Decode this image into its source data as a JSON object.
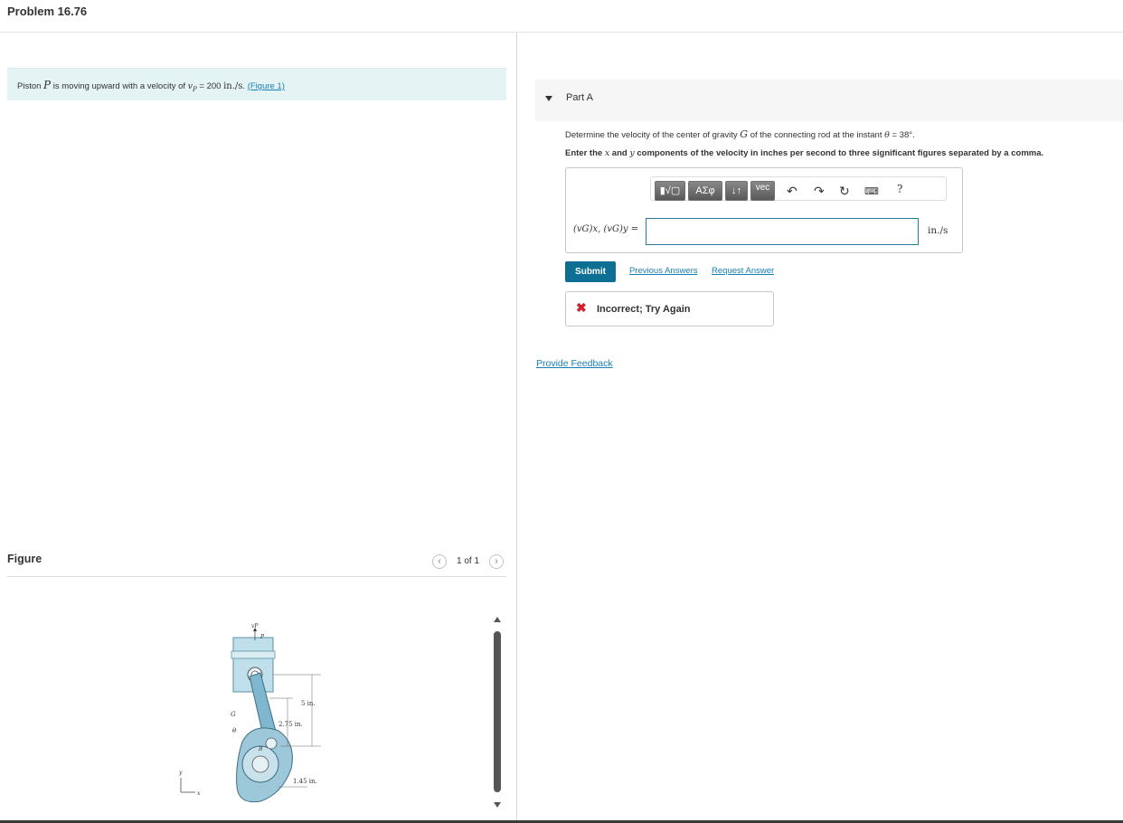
{
  "header": {
    "title": "Problem 16.76"
  },
  "intro": {
    "text_pre": "Piston ",
    "var_p": "P",
    "text_mid": " is moving upward with a velocity of ",
    "var_vp": "v",
    "var_vp_sub": "P",
    "value": " = 200 ",
    "unit": "in./s",
    "period": ". ",
    "figure_link": "(Figure 1)"
  },
  "figure_panel": {
    "title": "Figure",
    "pager_text": "1 of 1",
    "prev_icon": "chevron-left-icon",
    "next_icon": "chevron-right-icon",
    "labels": {
      "vp": "vP",
      "p": "P",
      "g": "G",
      "theta": "θ",
      "b": "B",
      "a": "A",
      "dim_5in": "5 in.",
      "dim_275in": "2.75 in.",
      "dim_145in": "1.45 in.",
      "axis_y": "y",
      "axis_x": "x"
    }
  },
  "part_a": {
    "label": "Part A",
    "question_1_pre": "Determine the velocity of the center of gravity ",
    "question_1_g": "G",
    "question_1_post": " of the connecting rod at the instant ",
    "question_1_theta": "θ",
    "question_1_value": " = 38°.",
    "question_2_pre": "Enter the ",
    "question_2_x": "x",
    "question_2_and": " and ",
    "question_2_y": "y",
    "question_2_post": " components of the velocity in inches per second to three significant figures separated by a comma.",
    "toolbar": {
      "templates_label": "▮√▢",
      "symbols_label": "ΑΣφ",
      "arrows_label": "↓↑",
      "vec_label": "vec",
      "undo_icon": "undo-icon",
      "redo_icon": "redo-icon",
      "reset_icon": "reset-icon",
      "keyboard_icon": "keyboard-icon",
      "help_label": "?"
    },
    "answer_label": "(vG)x, (vG)y =",
    "answer_value": "",
    "answer_unit": "in./s",
    "submit_label": "Submit",
    "previous_answers_label": "Previous Answers",
    "request_answer_label": "Request Answer",
    "feedback_text": "Incorrect; Try Again"
  },
  "provide_feedback_label": "Provide Feedback",
  "colors": {
    "accent": "#0e6f95",
    "link": "#1a7fb5",
    "error": "#d12030",
    "intro_bg": "#e4f3f4"
  }
}
